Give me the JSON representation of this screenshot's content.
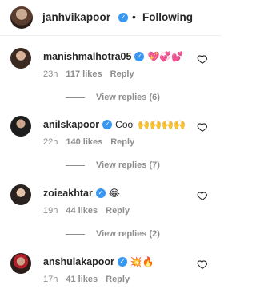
{
  "header": {
    "username": "janhvikapoor",
    "verified_mark": "✓",
    "separator": "•",
    "follow_status": "Following"
  },
  "comments": [
    {
      "username": "manishmalhotra05",
      "verified_mark": "✓",
      "text": "💖💞💕",
      "time": "23h",
      "likes": "117 likes",
      "reply_label": "Reply",
      "view_replies": "View replies (6)"
    },
    {
      "username": "anilskapoor",
      "verified_mark": "✓",
      "text": "Cool 🙌🙌🙌🙌",
      "time": "22h",
      "likes": "140 likes",
      "reply_label": "Reply",
      "view_replies": "View replies (7)"
    },
    {
      "username": "zoieakhtar",
      "verified_mark": "✓",
      "text": "😂",
      "time": "19h",
      "likes": "44 likes",
      "reply_label": "Reply",
      "view_replies": "View replies (2)"
    },
    {
      "username": "anshulakapoor",
      "verified_mark": "✓",
      "text": "💥🔥",
      "time": "17h",
      "likes": "41 likes",
      "reply_label": "Reply",
      "view_replies": ""
    }
  ],
  "colors": {
    "verified": "#3897f0",
    "meta_text": "#8e8e8e",
    "primary_text": "#262626"
  },
  "icons": {
    "verified": "verified-badge-icon",
    "like": "heart-outline-icon"
  }
}
